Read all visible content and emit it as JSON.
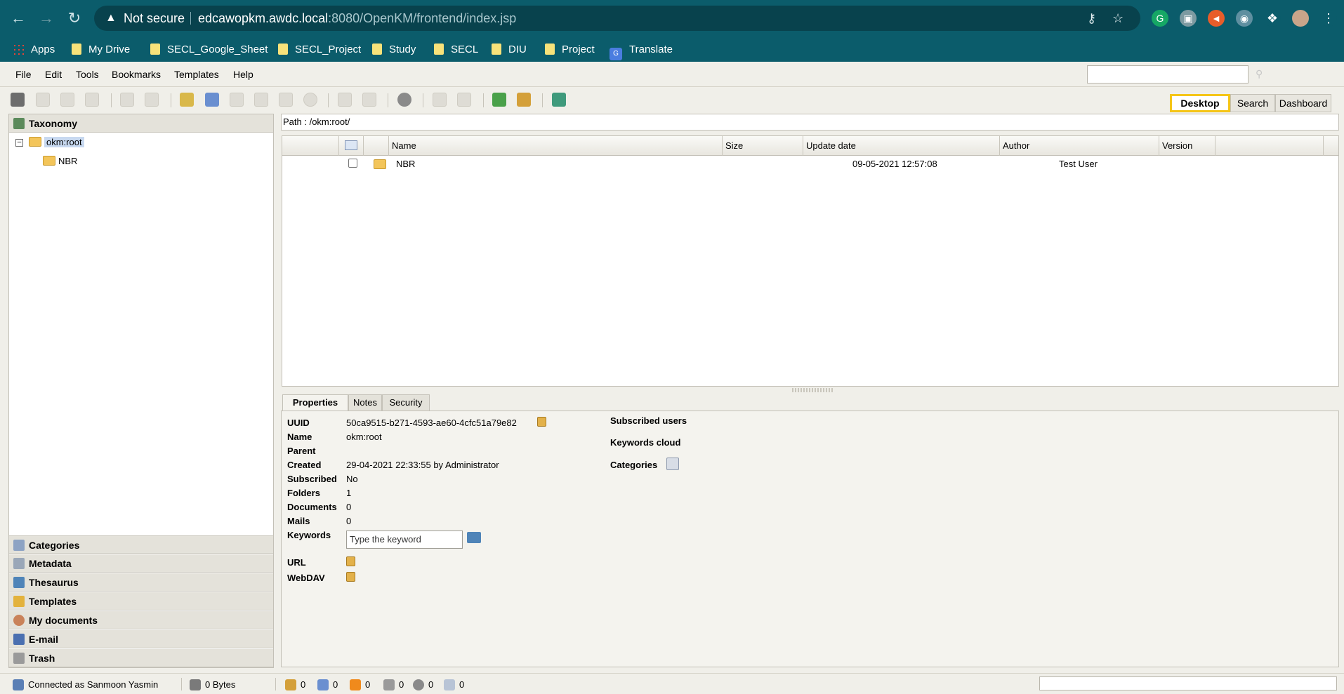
{
  "browser": {
    "security": "Not secure",
    "url_host": "edcawopkm.awdc.local",
    "url_rest": ":8080/OpenKM/frontend/index.jsp",
    "bookmarks": [
      "Apps",
      "My Drive",
      "SECL_Google_Sheet",
      "SECL_Project",
      "Study",
      "SECL",
      "DIU",
      "Project",
      "Translate"
    ]
  },
  "menu": [
    "File",
    "Edit",
    "Tools",
    "Bookmarks",
    "Templates",
    "Help"
  ],
  "workspace_tabs": [
    "Desktop",
    "Search",
    "Dashboard"
  ],
  "left_panel": {
    "taxonomy_label": "Taxonomy",
    "tree": {
      "root": "okm:root",
      "child": "NBR"
    },
    "stacks": [
      "Categories",
      "Metadata",
      "Thesaurus",
      "Templates",
      "My documents",
      "E-mail",
      "Trash"
    ]
  },
  "path": "Path : /okm:root/",
  "grid": {
    "columns": [
      "Name",
      "Size",
      "Update date",
      "Author",
      "Version"
    ],
    "rows": [
      {
        "name": "NBR",
        "size": "",
        "update_date": "09-05-2021 12:57:08",
        "author": "Test User",
        "version": ""
      }
    ]
  },
  "properties": {
    "tabs": [
      "Properties",
      "Notes",
      "Security"
    ],
    "labels": {
      "uuid": "UUID",
      "name": "Name",
      "parent": "Parent",
      "created": "Created",
      "subscribed": "Subscribed",
      "folders": "Folders",
      "documents": "Documents",
      "mails": "Mails",
      "keywords": "Keywords",
      "url": "URL",
      "webdav": "WebDAV"
    },
    "values": {
      "uuid": "50ca9515-b271-4593-ae60-4cfc51a79e82",
      "name": "okm:root",
      "parent": "",
      "created": "29-04-2021 22:33:55 by Administrator",
      "subscribed": "No",
      "folders": "1",
      "documents": "0",
      "mails": "0"
    },
    "keyword_placeholder": "Type the keyword",
    "right_labels": {
      "subscribed_users": "Subscribed users",
      "keywords_cloud": "Keywords cloud",
      "categories": "Categories"
    }
  },
  "status": {
    "connected": "Connected as Sanmoon Yasmin",
    "usage": "0 Bytes",
    "counters": [
      "0",
      "0",
      "0",
      "0",
      "0",
      "0"
    ]
  }
}
